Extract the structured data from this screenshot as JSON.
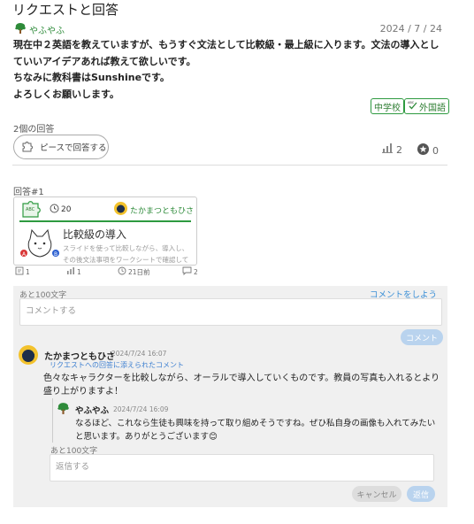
{
  "page": {
    "title": "リクエストと回答"
  },
  "request": {
    "author": "やふやふ",
    "date": "2024 / 7 / 24",
    "line1": "現在中２英語を教えていますが、もうすぐ文法として比較級・最上級に入ります。文法の導入としていいアイデアあれば教えて欲しいです。",
    "line2": "ちなみに教科書はSunshineです。",
    "line3": "よろしくお願いします。",
    "tags": [
      "中学校",
      "外国語"
    ]
  },
  "answers_meta": {
    "count_label": "2個の回答",
    "piece_button_label": "ピースで回答する",
    "stat_count": "2",
    "star_count": "0"
  },
  "answer": {
    "label": "回答#1",
    "timer_value": "20",
    "author": "たかまつともひさ",
    "title": "比較級の導入",
    "description": "スライドを使って比較しながら、導入し、その後文法事項をワークシートで確認していきます。",
    "stats": {
      "comments": "1",
      "views": "1",
      "time": "21日前",
      "replies": "2"
    }
  },
  "comments": {
    "remaining": "あと100文字",
    "post_link": "コメントをしよう",
    "placeholder": "コメントする",
    "submit_label": "コメント",
    "items": [
      {
        "author": "たかまつともひさ",
        "date": "2024/7/24 16:07",
        "note": "リクエストへの回答に添えられたコメント",
        "body": "色々なキャラクターを比較しながら、オーラルで導入していくものです。教員の写真も入れるとより盛り上がりますよ！"
      }
    ],
    "reply": {
      "author": "やふやふ",
      "date": "2024/7/24 16:09",
      "body": "なるほど、これなら生徒も興味を持って取り組めそうですね。ぜひ私自身の画像も入れてみたいと思います。ありがとうございます😊"
    },
    "reply_remaining": "あと100文字",
    "reply_placeholder": "返信する",
    "cancel_label": "キャンセル",
    "reply_label": "返信"
  }
}
